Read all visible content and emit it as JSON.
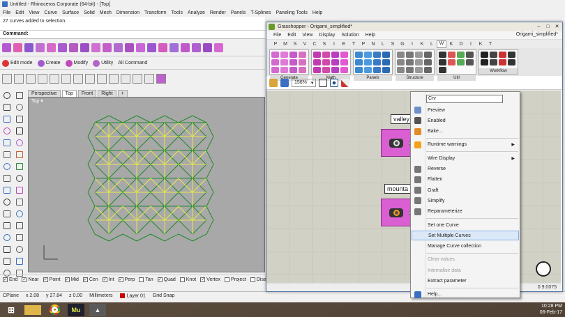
{
  "rhino": {
    "title": "Untitled - Rhinoceros Corporate (64-bit) - [Top]",
    "menu": [
      "File",
      "Edit",
      "View",
      "Curve",
      "Surface",
      "Solid",
      "Mesh",
      "Dimension",
      "Transform",
      "Tools",
      "Analyze",
      "Render",
      "Panels",
      "T-Splines",
      "Paneling Tools",
      "Help"
    ],
    "history": "27 curves added to selection.",
    "command_label": "Command:",
    "toolbar2": [
      "Edit mode",
      "Create",
      "Modify",
      "Utility",
      "All Command"
    ],
    "view_tabs": [
      "Perspective",
      "Top",
      "Front",
      "Right",
      "+"
    ],
    "viewport_label": "Top",
    "osnaps": [
      {
        "label": "End",
        "checked": true
      },
      {
        "label": "Near",
        "checked": true
      },
      {
        "label": "Point",
        "checked": true
      },
      {
        "label": "Mid",
        "checked": true
      },
      {
        "label": "Cen",
        "checked": true
      },
      {
        "label": "Int",
        "checked": true
      },
      {
        "label": "Perp",
        "checked": true
      },
      {
        "label": "Tan",
        "checked": false
      },
      {
        "label": "Quad",
        "checked": true
      },
      {
        "label": "Knot",
        "checked": false
      },
      {
        "label": "Vertex",
        "checked": true
      },
      {
        "label": "Project",
        "checked": false
      },
      {
        "label": "Disable",
        "checked": false
      }
    ],
    "status": {
      "cplane": "CPlane",
      "x": "x 2.08",
      "y": "y 27.84",
      "z": "z 0.00",
      "units": "Millimeters",
      "layer": "Layer 01",
      "grid": "Grid Snap"
    }
  },
  "grasshopper": {
    "title": "Grasshopper - Origami_simplified*",
    "menu": [
      "File",
      "Edit",
      "View",
      "Display",
      "Solution",
      "Help"
    ],
    "doc_name": "Origami_simplified*",
    "tabs": [
      "P",
      "M",
      "S",
      "V",
      "C",
      "S",
      "I",
      "E",
      "T",
      "P",
      "N",
      "L",
      "S",
      "G",
      "I",
      "K",
      "L",
      "W",
      "K",
      "D",
      "I",
      "K",
      "T"
    ],
    "active_tab_index": 17,
    "panels": [
      "Generate",
      "Math",
      "Panels",
      "Structure",
      "Util",
      "Workflow"
    ],
    "zoom": "156%",
    "components": [
      {
        "tag": "valley",
        "icon": "curve-param-icon"
      },
      {
        "tag": "mounta",
        "icon": "curve-param-icon"
      }
    ],
    "version": "0.9.0075"
  },
  "context_menu": {
    "search_value": "Crv",
    "items": [
      {
        "label": "Preview",
        "enabled": true,
        "icon": "preview-icon",
        "color": "#6e8fc9"
      },
      {
        "label": "Enabled",
        "enabled": true,
        "icon": "enabled-icon",
        "color": "#555555"
      },
      {
        "label": "Bake...",
        "enabled": true,
        "icon": "bake-icon",
        "color": "#e28b2a"
      },
      {
        "label": "Runtime warnings",
        "enabled": true,
        "icon": "warning-icon",
        "color": "#f3a21a",
        "submenu": true
      },
      {
        "label": "Wire Display",
        "enabled": true,
        "submenu": true
      },
      {
        "label": "Reverse",
        "enabled": true,
        "icon": "reverse-icon",
        "color": "#777777"
      },
      {
        "label": "Flatten",
        "enabled": true,
        "icon": "flatten-icon",
        "color": "#777777"
      },
      {
        "label": "Graft",
        "enabled": true,
        "icon": "graft-icon",
        "color": "#777777"
      },
      {
        "label": "Simplify",
        "enabled": true,
        "icon": "simplify-icon",
        "color": "#777777"
      },
      {
        "label": "Reparameterize",
        "enabled": true,
        "icon": "reparameterize-icon",
        "color": "#777777"
      },
      {
        "label": "Set one Curve",
        "enabled": true
      },
      {
        "label": "Set Multiple Curves",
        "enabled": true,
        "highlighted": true
      },
      {
        "label": "Manage Curve collection",
        "enabled": true
      },
      {
        "label": "Clear values",
        "enabled": false
      },
      {
        "label": "Internalise data",
        "enabled": false
      },
      {
        "label": "Extract parameter",
        "enabled": true
      },
      {
        "label": "Help...",
        "enabled": true,
        "icon": "help-icon",
        "color": "#3a6fc2"
      }
    ]
  },
  "taskbar": {
    "time": "10:28 PM",
    "date": "06-Feb-17",
    "apps": [
      "explorer",
      "chrome",
      "mu",
      "rhino"
    ]
  }
}
